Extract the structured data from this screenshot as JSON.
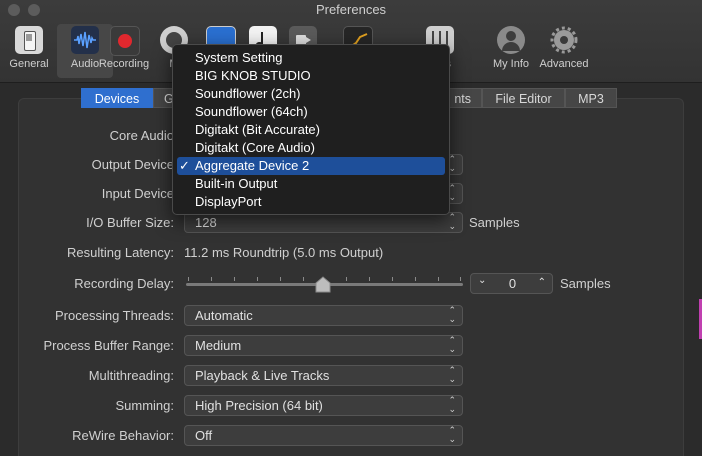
{
  "window": {
    "title": "Preferences"
  },
  "toolbar": {
    "items": [
      {
        "label": "General",
        "icon": "general-icon"
      },
      {
        "label": "Audio",
        "icon": "audio-waveform-icon"
      },
      {
        "label": "Recording",
        "icon": "record-icon"
      },
      {
        "label": "M",
        "icon": "midi-icon"
      },
      {
        "label": "",
        "icon": "display-icon"
      },
      {
        "label": "",
        "icon": "score-icon"
      },
      {
        "label": "",
        "icon": "movie-icon"
      },
      {
        "label": "",
        "icon": "automation-icon"
      },
      {
        "label": "rfaces",
        "icon": "control-surfaces-icon"
      },
      {
        "label": "My Info",
        "icon": "user-icon"
      },
      {
        "label": "Advanced",
        "icon": "gear-icon"
      }
    ]
  },
  "tabs": {
    "devices": "Devices",
    "general": "G",
    "editing": "nts",
    "file_editor": "File Editor",
    "mp3": "MP3"
  },
  "form": {
    "core_audio_label": "Core Audio",
    "output_device_label": "Output Device",
    "input_device_label": "Input Device",
    "io_buffer_label": "I/O Buffer Size:",
    "io_buffer_value": "128",
    "io_buffer_units": "Samples",
    "latency_label": "Resulting Latency:",
    "latency_value": "11.2 ms Roundtrip (5.0 ms Output)",
    "recording_delay_label": "Recording Delay:",
    "recording_delay_value": "0",
    "recording_delay_units": "Samples",
    "recording_delay_slider_fraction": 0.5,
    "processing_threads_label": "Processing Threads:",
    "processing_threads_value": "Automatic",
    "buffer_range_label": "Process Buffer Range:",
    "buffer_range_value": "Medium",
    "multithreading_label": "Multithreading:",
    "multithreading_value": "Playback & Live Tracks",
    "summing_label": "Summing:",
    "summing_value": "High Precision (64 bit)",
    "rewire_label": "ReWire Behavior:",
    "rewire_value": "Off"
  },
  "menu": {
    "items": [
      "System Setting",
      "BIG KNOB STUDIO",
      "Soundflower (2ch)",
      "Soundflower (64ch)",
      "Digitakt (Bit Accurate)",
      "Digitakt (Core Audio)",
      "Aggregate Device 2",
      "Built-in Output",
      "DisplayPort"
    ],
    "selected": "Aggregate Device 2",
    "check_glyph": "✓"
  },
  "colors": {
    "accent": "#2f6fcf",
    "menu_selection": "#1e4f9a",
    "record_red": "#e0282e"
  }
}
